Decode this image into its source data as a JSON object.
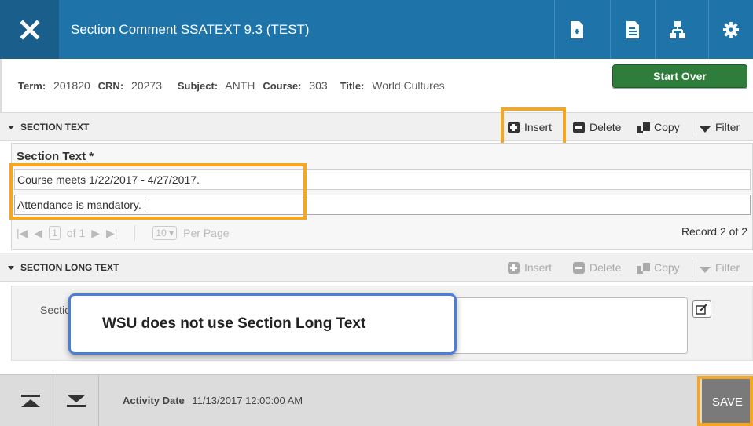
{
  "header": {
    "title": "Section Comment SSATEXT 9.3 (TEST)",
    "colors": {
      "bar": "#1e73a8",
      "close": "#1a5f8c"
    },
    "tools": [
      "add-document-icon",
      "related-document-icon",
      "tools-hierarchy-icon",
      "gear-icon"
    ]
  },
  "keyblock": {
    "term_label": "Term:",
    "term_value": "201820",
    "crn_label": "CRN:",
    "crn_value": "20273",
    "subject_label": "Subject:",
    "subject_value": "ANTH",
    "course_label": "Course:",
    "course_value": "303",
    "title_label": "Title:",
    "title_value": "World Cultures",
    "start_over": "Start Over"
  },
  "section_text": {
    "header": "SECTION TEXT",
    "actions": {
      "insert": "Insert",
      "delete": "Delete",
      "copy": "Copy",
      "filter": "Filter"
    },
    "column_header": "Section Text *",
    "rows": [
      "Course meets 1/22/2017 - 4/27/2017.",
      "Attendance is mandatory."
    ],
    "pager": {
      "page": "1",
      "of_label": "of 1",
      "per_page_value": "10",
      "per_page_label": "Per Page"
    },
    "record_count": "Record 2 of 2"
  },
  "section_long_text": {
    "header": "SECTION LONG TEXT",
    "actions": {
      "insert": "Insert",
      "delete": "Delete",
      "copy": "Copy",
      "filter": "Filter"
    },
    "field_label": "Sectio",
    "callout": "WSU does not use Section Long Text"
  },
  "footer": {
    "activity_label": "Activity Date",
    "activity_value": "11/13/2017 12:00:00 AM",
    "save": "SAVE"
  },
  "highlight_color": "#f5a623"
}
